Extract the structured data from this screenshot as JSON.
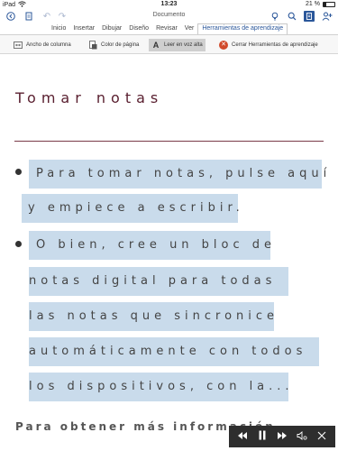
{
  "status_bar": {
    "device": "iPad",
    "time": "13:23",
    "battery": "21 %"
  },
  "title_bar": {
    "document_title": "Documento"
  },
  "ribbon": {
    "tabs": [
      "Inicio",
      "Insertar",
      "Dibujar",
      "Diseño",
      "Revisar",
      "Ver",
      "Herramientas de aprendizaje"
    ],
    "active_tab_index": 6,
    "tools": {
      "column_width": "Ancho de columna",
      "page_color": "Color de página",
      "read_aloud": "Leer en voz alta",
      "close_tools": "Cerrar Herramientas de aprendizaje"
    }
  },
  "document": {
    "heading": "Tomar notas",
    "bullet1_lines": [
      "Para tomar notas, pulse aquí",
      "y empiece a escribir."
    ],
    "bullet2_lines": [
      "O bien, cree un bloc de",
      "notas digital para todas",
      "las notas que sincronice",
      "automáticamente con todos",
      "los dispositivos, con la..."
    ],
    "partial_line": "Para obtener más información"
  },
  "colors": {
    "accent": "#2b579a",
    "heading": "#5a2030",
    "highlight": "#c9dbeb"
  }
}
